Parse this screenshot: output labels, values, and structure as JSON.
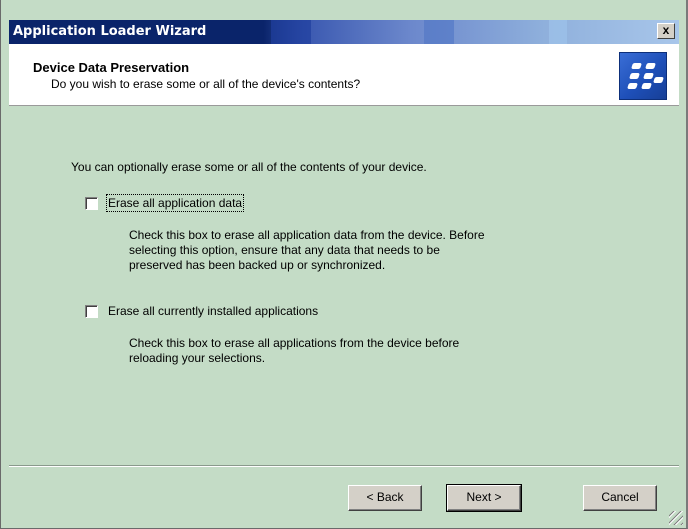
{
  "window": {
    "title": "Application Loader Wizard",
    "close_label": "x"
  },
  "header": {
    "title": "Device Data Preservation",
    "subtitle": "Do you wish to erase some or all of the device's contents?",
    "logo_icon": "blackberry-logo-icon"
  },
  "content": {
    "intro": "You can optionally erase some or all of the contents of your device.",
    "options": [
      {
        "label": "Erase all application data",
        "checked": false,
        "description_lines": [
          "Check this box to erase all application data from the device. Before",
          "selecting this option, ensure that any data that needs to be",
          "preserved has been backed up or synchronized."
        ]
      },
      {
        "label": "Erase all currently installed applications",
        "checked": false,
        "description_lines": [
          "Check this box to erase all applications from the device before",
          "reloading your selections."
        ]
      }
    ]
  },
  "buttons": {
    "back": "< Back",
    "next": "Next >",
    "cancel": "Cancel"
  },
  "colors": {
    "body_background": "#c4dcc6",
    "titlebar_start": "#0a246a",
    "titlebar_end": "#a8c6ea",
    "logo_blue": "#1e4fb8"
  }
}
